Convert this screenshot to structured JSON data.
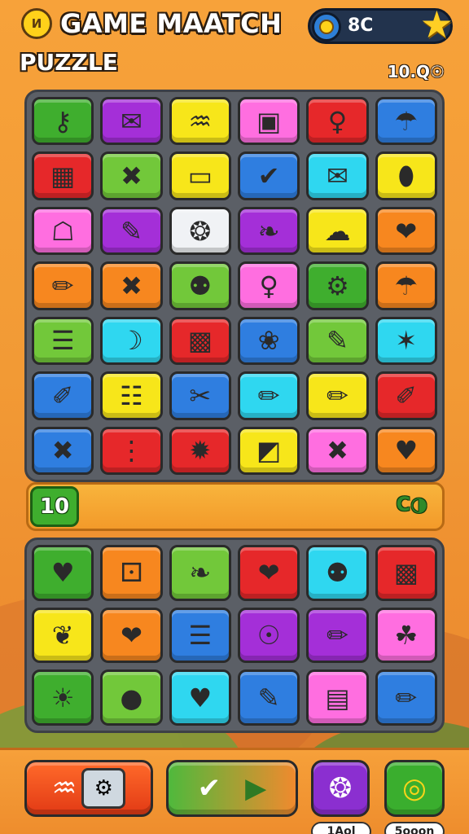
{
  "header": {
    "logo_glyph": "И",
    "title": "GAME MAATCH",
    "subtitle": "PUZZLE",
    "coins": "8C",
    "score": "10.Q☉"
  },
  "colors": {
    "green": "#3fae2e",
    "purple": "#a42fd8",
    "yellow": "#f7e61a",
    "pink": "#ff6ee0",
    "red": "#e6282a",
    "blue": "#2f7ee0",
    "cyan": "#2fd7f0",
    "orange": "#f7871f",
    "white": "#f0f2f5",
    "lime": "#72c83a"
  },
  "board_top": [
    {
      "icon": "key-icon",
      "glyph": "⚷",
      "bg": "#3fae2e"
    },
    {
      "icon": "paper-icon",
      "glyph": "✉",
      "bg": "#a42fd8"
    },
    {
      "icon": "bench-icon",
      "glyph": "♒",
      "bg": "#f7e61a"
    },
    {
      "icon": "box-icon",
      "glyph": "▣",
      "bg": "#ff6ee0"
    },
    {
      "icon": "lollipop-icon",
      "glyph": "♀",
      "bg": "#e6282a"
    },
    {
      "icon": "umbrella-icon",
      "glyph": "☂",
      "bg": "#2f7ee0"
    },
    {
      "icon": "crate-icon",
      "glyph": "▦",
      "bg": "#e6282a"
    },
    {
      "icon": "cross-icon",
      "glyph": "✖",
      "bg": "#72c83a"
    },
    {
      "icon": "card-icon",
      "glyph": "▭",
      "bg": "#f7e61a"
    },
    {
      "icon": "check-icon",
      "glyph": "✔",
      "bg": "#2f7ee0"
    },
    {
      "icon": "envelope-icon",
      "glyph": "✉",
      "bg": "#2fd7f0"
    },
    {
      "icon": "gem-icon",
      "glyph": "⬮",
      "bg": "#f7e61a"
    },
    {
      "icon": "bag-icon",
      "glyph": "☖",
      "bg": "#ff6ee0"
    },
    {
      "icon": "brush-icon",
      "glyph": "✎",
      "bg": "#a42fd8"
    },
    {
      "icon": "dial-icon",
      "glyph": "❂",
      "bg": "#f0f2f5"
    },
    {
      "icon": "wing-icon",
      "glyph": "❧",
      "bg": "#a42fd8"
    },
    {
      "icon": "cloud-icon",
      "glyph": "☁",
      "bg": "#f7e61a"
    },
    {
      "icon": "apple-icon",
      "glyph": "❤",
      "bg": "#f7871f"
    },
    {
      "icon": "pencil-icon",
      "glyph": "✏",
      "bg": "#f7871f"
    },
    {
      "icon": "cross-icon",
      "glyph": "✖",
      "bg": "#f7871f"
    },
    {
      "icon": "pin-icon",
      "glyph": "⚉",
      "bg": "#72c83a"
    },
    {
      "icon": "lollipop-icon",
      "glyph": "♀",
      "bg": "#ff6ee0"
    },
    {
      "icon": "gear-icon",
      "glyph": "⚙",
      "bg": "#3fae2e"
    },
    {
      "icon": "umbrella-icon",
      "glyph": "☂",
      "bg": "#f7871f"
    },
    {
      "icon": "notepad-icon",
      "glyph": "☰",
      "bg": "#72c83a"
    },
    {
      "icon": "banana-icon",
      "glyph": "☽",
      "bg": "#2fd7f0"
    },
    {
      "icon": "picture-icon",
      "glyph": "▩",
      "bg": "#e6282a"
    },
    {
      "icon": "corn-icon",
      "glyph": "❀",
      "bg": "#2f7ee0"
    },
    {
      "icon": "scroll-icon",
      "glyph": "✎",
      "bg": "#72c83a"
    },
    {
      "icon": "sticks-icon",
      "glyph": "✶",
      "bg": "#2fd7f0"
    },
    {
      "icon": "pen-icon",
      "glyph": "✐",
      "bg": "#2f7ee0"
    },
    {
      "icon": "calculator-icon",
      "glyph": "☷",
      "bg": "#f7e61a"
    },
    {
      "icon": "scissors-icon",
      "glyph": "✂",
      "bg": "#2f7ee0"
    },
    {
      "icon": "marker-icon",
      "glyph": "✏",
      "bg": "#2fd7f0"
    },
    {
      "icon": "pencil-icon",
      "glyph": "✏",
      "bg": "#f7e61a"
    },
    {
      "icon": "pen-icon",
      "glyph": "✐",
      "bg": "#e6282a"
    },
    {
      "icon": "cross-icon",
      "glyph": "✖",
      "bg": "#2f7ee0"
    },
    {
      "icon": "traffic-light-icon",
      "glyph": "⋮",
      "bg": "#e6282a"
    },
    {
      "icon": "burst-icon",
      "glyph": "✹",
      "bg": "#e6282a"
    },
    {
      "icon": "paper-icon",
      "glyph": "◩",
      "bg": "#f7e61a"
    },
    {
      "icon": "cross-icon",
      "glyph": "✖",
      "bg": "#ff6ee0"
    },
    {
      "icon": "heart-icon",
      "glyph": "♥",
      "bg": "#f7871f"
    }
  ],
  "progress": {
    "level": "10",
    "right_label": "C◑"
  },
  "board_bottom": [
    {
      "icon": "heart-icon",
      "glyph": "♥",
      "bg": "#3fae2e"
    },
    {
      "icon": "dice-icon",
      "glyph": "⚀",
      "bg": "#f7871f"
    },
    {
      "icon": "cucumber-icon",
      "glyph": "❧",
      "bg": "#72c83a"
    },
    {
      "icon": "apple-icon",
      "glyph": "❤",
      "bg": "#e6282a"
    },
    {
      "icon": "balloon-icon",
      "glyph": "⚉",
      "bg": "#2fd7f0"
    },
    {
      "icon": "picture-icon",
      "glyph": "▩",
      "bg": "#e6282a"
    },
    {
      "icon": "bone-icon",
      "glyph": "❦",
      "bg": "#f7e61a"
    },
    {
      "icon": "apple-icon",
      "glyph": "❤",
      "bg": "#f7871f"
    },
    {
      "icon": "notepad-icon",
      "glyph": "☰",
      "bg": "#2f7ee0"
    },
    {
      "icon": "compass-icon",
      "glyph": "☉",
      "bg": "#a42fd8"
    },
    {
      "icon": "pencil-icon",
      "glyph": "✏",
      "bg": "#a42fd8"
    },
    {
      "icon": "leaf-icon",
      "glyph": "☘",
      "bg": "#ff6ee0"
    },
    {
      "icon": "sun-icon",
      "glyph": "☀",
      "bg": "#3fae2e"
    },
    {
      "icon": "apple-icon",
      "glyph": "●",
      "bg": "#72c83a"
    },
    {
      "icon": "heart-icon",
      "glyph": "♥",
      "bg": "#2fd7f0"
    },
    {
      "icon": "brush-icon",
      "glyph": "✎",
      "bg": "#2f7ee0"
    },
    {
      "icon": "camera-icon",
      "glyph": "▤",
      "bg": "#ff6ee0"
    },
    {
      "icon": "pencil-icon",
      "glyph": "✏",
      "bg": "#2f7ee0"
    }
  ],
  "bottom": {
    "btn_a_icon": "♒",
    "btn_a_box": "⚙",
    "btn_b_icon": "✔",
    "btn_b_play": "▶",
    "btn_c_icon": "❂",
    "btn_d_icon": "◎",
    "chip_a": "1Aol",
    "chip_b": "5ooon"
  }
}
